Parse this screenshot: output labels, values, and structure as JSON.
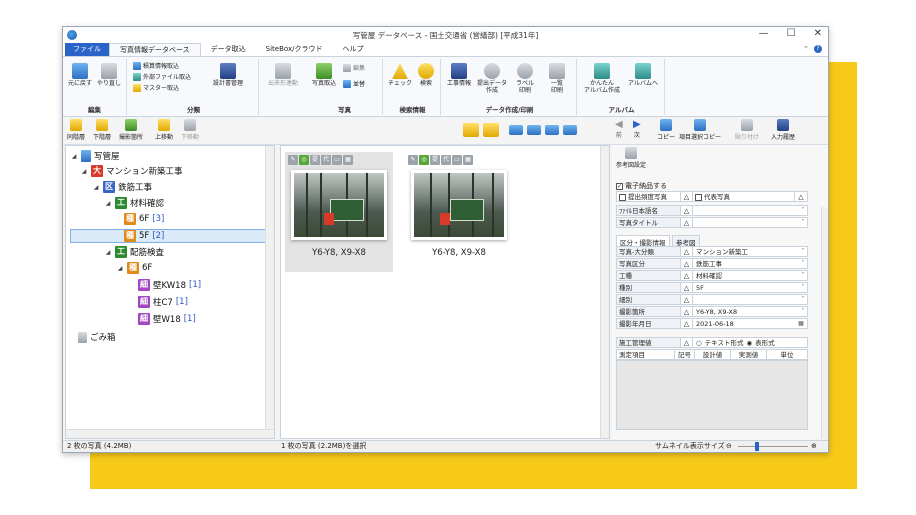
{
  "window": {
    "title": "写管屋 データベース - 国土交通省 (営繕部) [平成31年]",
    "controls": [
      "—",
      "☐",
      "✕"
    ]
  },
  "ribbon_tabs": [
    "ファイル",
    "写真情報データベース",
    "データ取込",
    "SiteBox/クラウド",
    "ヘルプ"
  ],
  "ribbon": {
    "groups": {
      "edit": "編集",
      "classify": "分類",
      "photo": "写真",
      "search": "検索情報",
      "data": "データ作成/印刷",
      "album": "アルバム"
    },
    "buttons": {
      "undo": "元に戻す",
      "redo": "やり直し",
      "sekisan": "積算情報取込",
      "external": "外部ファイル取込",
      "master": "マスター取込",
      "design": "設計書管理",
      "dekigata": "出来形連動",
      "photo_import": "写真取込",
      "edit_btn": "編集",
      "sort": "並替",
      "check": "チェック",
      "search": "検索",
      "koji": "工事情報",
      "submit_data_1": "提出データ",
      "submit_data_2": "作成",
      "label_1": "ラベル",
      "label_2": "印刷",
      "list_1": "一覧",
      "list_2": "印刷",
      "easy_album_1": "かんたん",
      "easy_album_2": "アルバム作成",
      "to_album": "アルバムへ"
    }
  },
  "toolbar2": {
    "same_level": "同階層",
    "lower_level": "下階層",
    "location": "撮影箇所",
    "move_up": "上移動",
    "move_down": "下移動",
    "prev": "前",
    "next": "次",
    "copy": "コピー",
    "item_copy": "項目選択コピー",
    "paste": "貼り付け",
    "history": "入力履歴",
    "ref_settings": "参考図設定"
  },
  "tree": {
    "root": "写管屋",
    "items": [
      {
        "badge": "大",
        "label": "マンション新築工事"
      },
      {
        "badge": "区",
        "label": "鉄筋工事"
      },
      {
        "badge": "工",
        "label": "材料確認"
      },
      {
        "badge": "種",
        "label": "6F",
        "count": "[3]"
      },
      {
        "badge": "種",
        "label": "5F",
        "count": "[2]"
      },
      {
        "badge": "工",
        "label": "配筋検査"
      },
      {
        "badge": "種",
        "label": "6F"
      },
      {
        "badge": "細",
        "label": "壁KW18",
        "count": "[1]"
      },
      {
        "badge": "細",
        "label": "柱C7",
        "count": "[1]"
      },
      {
        "badge": "細",
        "label": "壁W18",
        "count": "[1]"
      }
    ],
    "trash": "ごみ箱"
  },
  "thumbnails": [
    {
      "caption": "Y6-Y8, X9-X8",
      "icons": [
        "✎",
        "◎",
        "提",
        "代",
        "▭",
        "▦"
      ]
    },
    {
      "caption": "Y6-Y8, X9-X8",
      "icons": [
        "✎",
        "◎",
        "提",
        "代",
        "▭",
        "▦"
      ]
    }
  ],
  "properties": {
    "electronic": "電子納品する",
    "submit_freq": "提出頻度写真",
    "rep_photo": "代表写真",
    "file_name_label": "ﾌｧｲﾙ日本語名",
    "photo_title_label": "写真タイトル",
    "tab_class": "区分・撮影情報",
    "tab_ref": "参考図",
    "rows": [
      {
        "label": "写真-大分類",
        "value": "マンション新築工"
      },
      {
        "label": "写真区分",
        "value": "鉄筋工事"
      },
      {
        "label": "工種",
        "value": "材料確認"
      },
      {
        "label": "種別",
        "value": "5F"
      },
      {
        "label": "細別",
        "value": ""
      },
      {
        "label": "撮影箇所",
        "value": "Y6-Y8, X9-X8"
      },
      {
        "label": "撮影年月日",
        "value": "2021-06-18"
      }
    ],
    "kanri_label": "施工管理値",
    "text_format": "テキスト形式",
    "table_format": "表形式",
    "cols": [
      "測定項目",
      "記号",
      "設計値",
      "実測値",
      "単位"
    ]
  },
  "status": {
    "left": "2 枚の写真 (4.2MB)",
    "mid": "1 枚の写真 (2.2MB)を選択",
    "right": "サムネイル表示サイズ"
  }
}
